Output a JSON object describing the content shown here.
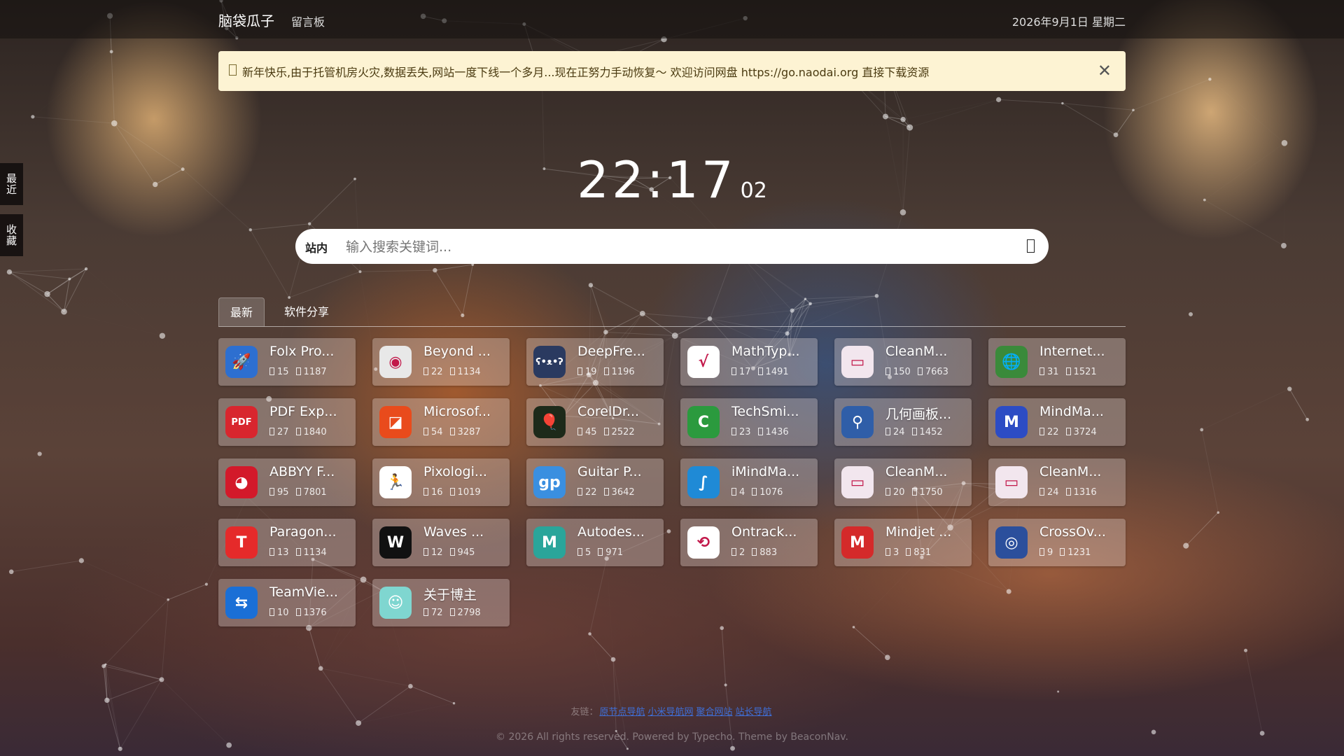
{
  "colors": {
    "notice_bg": "#fdf3d3",
    "link": "#3f6fd8"
  },
  "header": {
    "brand": "脑袋瓜子",
    "nav_link": "留言板",
    "date": "2026年9月1日 星期二"
  },
  "notice": {
    "icon": "notice-icon",
    "text": "新年快乐,由于托管机房火灾,数据丢失,网站一度下线一个多月...现在正努力手动恢复～ 欢迎访问网盘 https://go.naodai.org 直接下载资源",
    "close_icon": "close-icon"
  },
  "side_tabs": {
    "recent": "最近",
    "favorites": "收藏"
  },
  "clock": {
    "hours_minutes": "22:17",
    "seconds": "02"
  },
  "search": {
    "scope_label": "站内",
    "placeholder": "输入搜索关键词...",
    "button_icon": "search-icon"
  },
  "tabs": [
    {
      "label": "最新",
      "active": true
    },
    {
      "label": "软件分享",
      "active": false
    }
  ],
  "meta_icons": {
    "comments": "comment-icon",
    "views": "eye-icon"
  },
  "cards": [
    {
      "title": "Folx Pro...",
      "comments": "15",
      "views": "1187",
      "icon": "rocket-icon",
      "icon_color": "#2d6fd0",
      "glyph": "🚀"
    },
    {
      "title": "Beyond ...",
      "comments": "22",
      "views": "1134",
      "icon": "disc-icon",
      "icon_color": "#e8e8e8",
      "glyph": "◉"
    },
    {
      "title": "DeepFre...",
      "comments": "19",
      "views": "1196",
      "icon": "bear-icon",
      "icon_color": "#2a3a60",
      "glyph": "ʕ•ᴥ•ʔ"
    },
    {
      "title": "MathTyp...",
      "comments": "17",
      "views": "1491",
      "icon": "mathtype-icon",
      "icon_color": "#ffffff",
      "glyph": "√"
    },
    {
      "title": "CleanM...",
      "comments": "150",
      "views": "7663",
      "icon": "monitor-icon",
      "icon_color": "#f2e6ee",
      "glyph": "▭"
    },
    {
      "title": "Internet...",
      "comments": "31",
      "views": "1521",
      "icon": "globe-icon",
      "icon_color": "#3a8a3a",
      "glyph": "🌐"
    },
    {
      "title": "PDF Exp...",
      "comments": "27",
      "views": "1840",
      "icon": "pdf-icon",
      "icon_color": "#d8262e",
      "glyph": "PDF"
    },
    {
      "title": "Microsof...",
      "comments": "54",
      "views": "3287",
      "icon": "office-icon",
      "icon_color": "#e94b1c",
      "glyph": "◪"
    },
    {
      "title": "CorelDr...",
      "comments": "45",
      "views": "2522",
      "icon": "balloon-icon",
      "icon_color": "#1d2a1a",
      "glyph": "🎈"
    },
    {
      "title": "TechSmi...",
      "comments": "23",
      "views": "1436",
      "icon": "camtasia-icon",
      "icon_color": "#2b9a3e",
      "glyph": "C"
    },
    {
      "title": "几何画板...",
      "comments": "24",
      "views": "1452",
      "icon": "compass-icon",
      "icon_color": "#2f5ea8",
      "glyph": "⚲"
    },
    {
      "title": "MindMa...",
      "comments": "22",
      "views": "3724",
      "icon": "mindmanager-icon",
      "icon_color": "#2c4cc4",
      "glyph": "M"
    },
    {
      "title": "ABBYY F...",
      "comments": "95",
      "views": "7801",
      "icon": "eye-logo-icon",
      "icon_color": "#d3192a",
      "glyph": "◕"
    },
    {
      "title": "Pixologi...",
      "comments": "16",
      "views": "1019",
      "icon": "figure-icon",
      "icon_color": "#ffffff",
      "glyph": "🏃"
    },
    {
      "title": "Guitar P...",
      "comments": "22",
      "views": "3642",
      "icon": "guitar-pro-icon",
      "icon_color": "#3a8fe0",
      "glyph": "gp"
    },
    {
      "title": "iMindMa...",
      "comments": "4",
      "views": "1076",
      "icon": "imindmap-icon",
      "icon_color": "#1f8ad6",
      "glyph": "∫"
    },
    {
      "title": "CleanM...",
      "comments": "20",
      "views": "1750",
      "icon": "monitor-icon",
      "icon_color": "#f2e6ee",
      "glyph": "▭"
    },
    {
      "title": "CleanM...",
      "comments": "24",
      "views": "1316",
      "icon": "monitor-icon",
      "icon_color": "#f2e6ee",
      "glyph": "▭"
    },
    {
      "title": "Paragon...",
      "comments": "13",
      "views": "1134",
      "icon": "paragon-icon",
      "icon_color": "#e52a2a",
      "glyph": "T"
    },
    {
      "title": "Waves ...",
      "comments": "12",
      "views": "945",
      "icon": "waves-icon",
      "icon_color": "#111111",
      "glyph": "W"
    },
    {
      "title": "Autodes...",
      "comments": "5",
      "views": "971",
      "icon": "maya-icon",
      "icon_color": "#2aa59a",
      "glyph": "M"
    },
    {
      "title": "Ontrack...",
      "comments": "2",
      "views": "883",
      "icon": "easyrecovery-icon",
      "icon_color": "#ffffff",
      "glyph": "⟲"
    },
    {
      "title": "Mindjet ...",
      "comments": "3",
      "views": "831",
      "icon": "mindjet-icon",
      "icon_color": "#d42a2a",
      "glyph": "M"
    },
    {
      "title": "CrossOv...",
      "comments": "9",
      "views": "1231",
      "icon": "crossover-icon",
      "icon_color": "#2b4f9c",
      "glyph": "◎"
    },
    {
      "title": "TeamVie...",
      "comments": "10",
      "views": "1376",
      "icon": "teamviewer-icon",
      "icon_color": "#1a6fd6",
      "glyph": "⇆"
    },
    {
      "title": "关于博主",
      "comments": "72",
      "views": "2798",
      "icon": "avatar-icon",
      "icon_color": "#7fd6d0",
      "glyph": "☺"
    }
  ],
  "footer": {
    "friends_label": "友链：",
    "friends": [
      "原节点导航",
      "小米导航网",
      "聚合网站",
      "站长导航"
    ],
    "copyright": "© 2026 All rights reserved. Powered by Typecho. Theme by BeaconNav."
  }
}
